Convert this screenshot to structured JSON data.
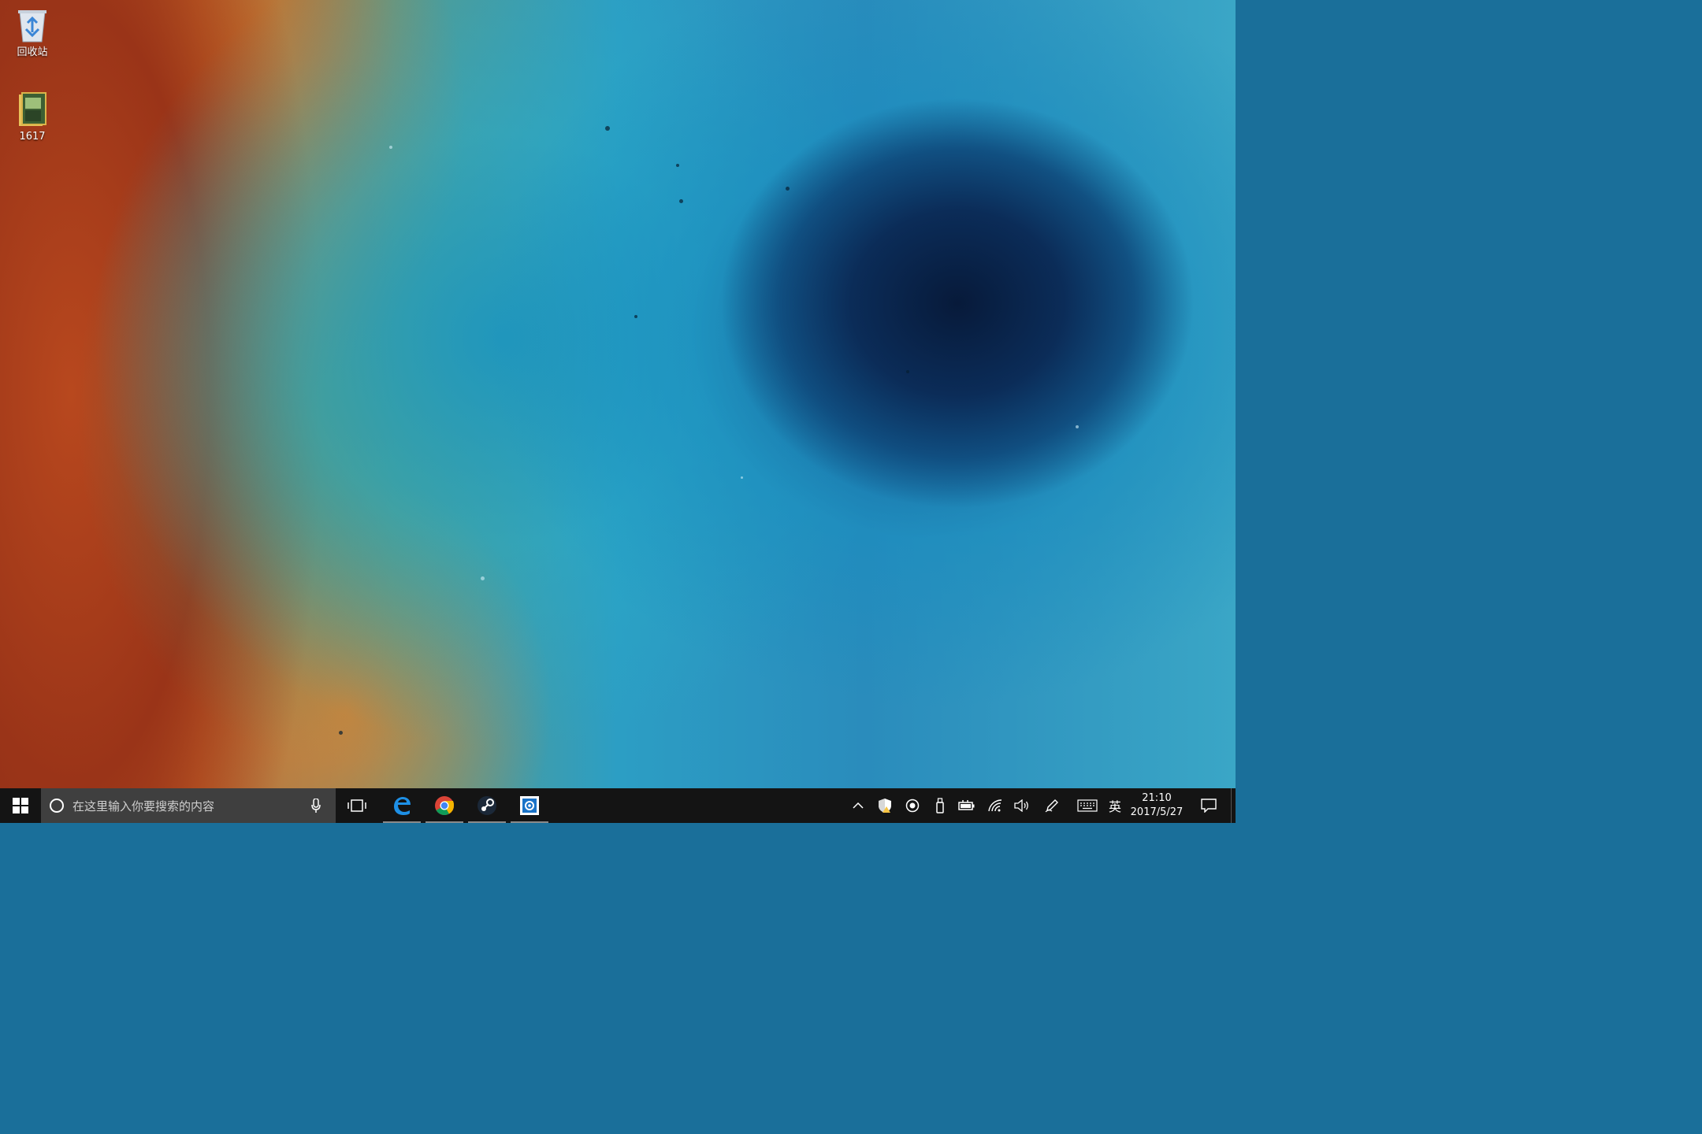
{
  "desktop": {
    "icons": [
      {
        "label": "回收站",
        "icon": "recycle-bin-icon"
      },
      {
        "label": "1617",
        "icon": "folder-icon"
      }
    ]
  },
  "taskbar": {
    "search_placeholder": "在这里输入你要搜索的内容",
    "pinned_apps": [
      "edge-icon",
      "chrome-icon",
      "steam-icon",
      "remote-desktop-icon"
    ],
    "tray": {
      "ime_label": "英",
      "time": "21:10",
      "date": "2017/5/27"
    }
  }
}
